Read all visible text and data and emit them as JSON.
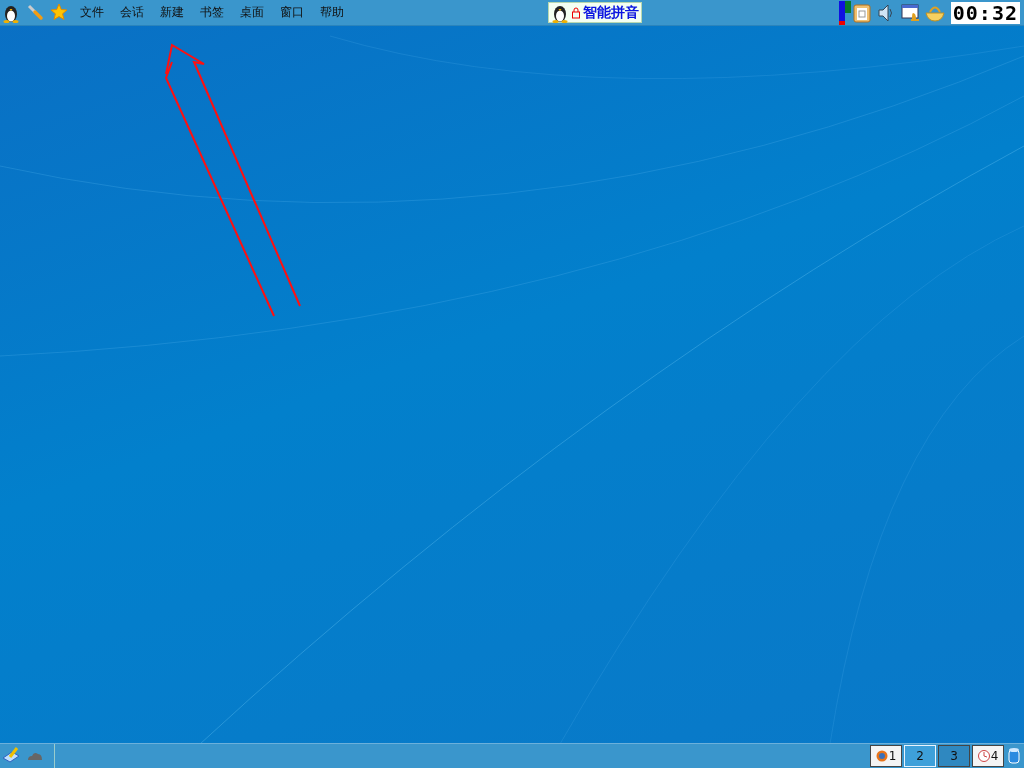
{
  "top_panel": {
    "menu": [
      "文件",
      "会话",
      "新建",
      "书签",
      "桌面",
      "窗口",
      "帮助"
    ],
    "input_method": {
      "label": "智能拼音"
    },
    "clock": "00:32"
  },
  "bottom_panel": {
    "desktops": [
      {
        "label": "1",
        "selected": false,
        "kind": "browser"
      },
      {
        "label": "2",
        "selected": true,
        "kind": "empty"
      },
      {
        "label": "3",
        "selected": false,
        "kind": "empty"
      },
      {
        "label": "4",
        "selected": false,
        "kind": "clock"
      }
    ]
  }
}
